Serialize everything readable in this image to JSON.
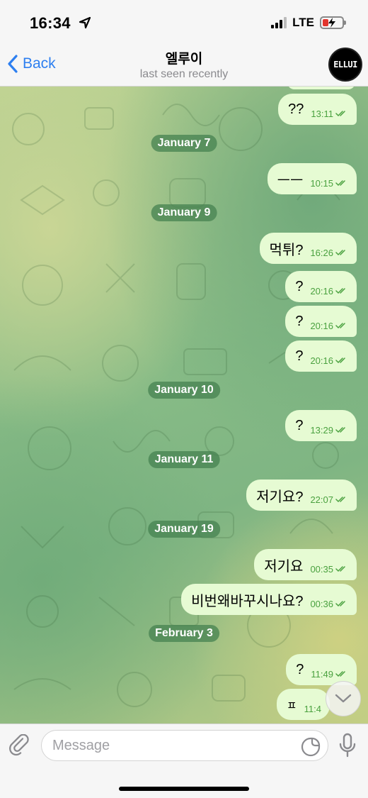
{
  "status_bar": {
    "time": "16:34",
    "network": "LTE"
  },
  "nav": {
    "back_label": "Back",
    "title": "엘루이",
    "subtitle": "last seen recently",
    "avatar_text": "ELLUI"
  },
  "colors": {
    "accent": "#2d7ff0",
    "bubble_out": "#e6fbd3",
    "time_green": "#4aa13f",
    "date_pill": "#4b8656"
  },
  "chat": {
    "dates": [
      "January 7",
      "January 9",
      "January 10",
      "January 11",
      "January 19",
      "February 3"
    ],
    "messages": [
      {
        "text": "??",
        "time": "13:11"
      },
      {
        "text": "ㅡㅡ",
        "time": "10:15"
      },
      {
        "text": "먹튀?",
        "time": "16:26"
      },
      {
        "text": "?",
        "time": "20:16"
      },
      {
        "text": "?",
        "time": "20:16"
      },
      {
        "text": "?",
        "time": "20:16"
      },
      {
        "text": "?",
        "time": "13:29"
      },
      {
        "text": "저기요?",
        "time": "22:07"
      },
      {
        "text": "저기요",
        "time": "00:35"
      },
      {
        "text": "비번왜바꾸시나요?",
        "time": "00:36"
      },
      {
        "text": "?",
        "time": "11:49"
      },
      {
        "text": "ㅍ",
        "time": "11:4"
      }
    ]
  },
  "input": {
    "placeholder": "Message"
  },
  "icons": {
    "back": "chevron-left-icon",
    "attach": "paperclip-icon",
    "sticker": "sticker-icon",
    "mic": "microphone-icon",
    "scroll": "chevron-down-icon",
    "location": "location-arrow-icon"
  }
}
